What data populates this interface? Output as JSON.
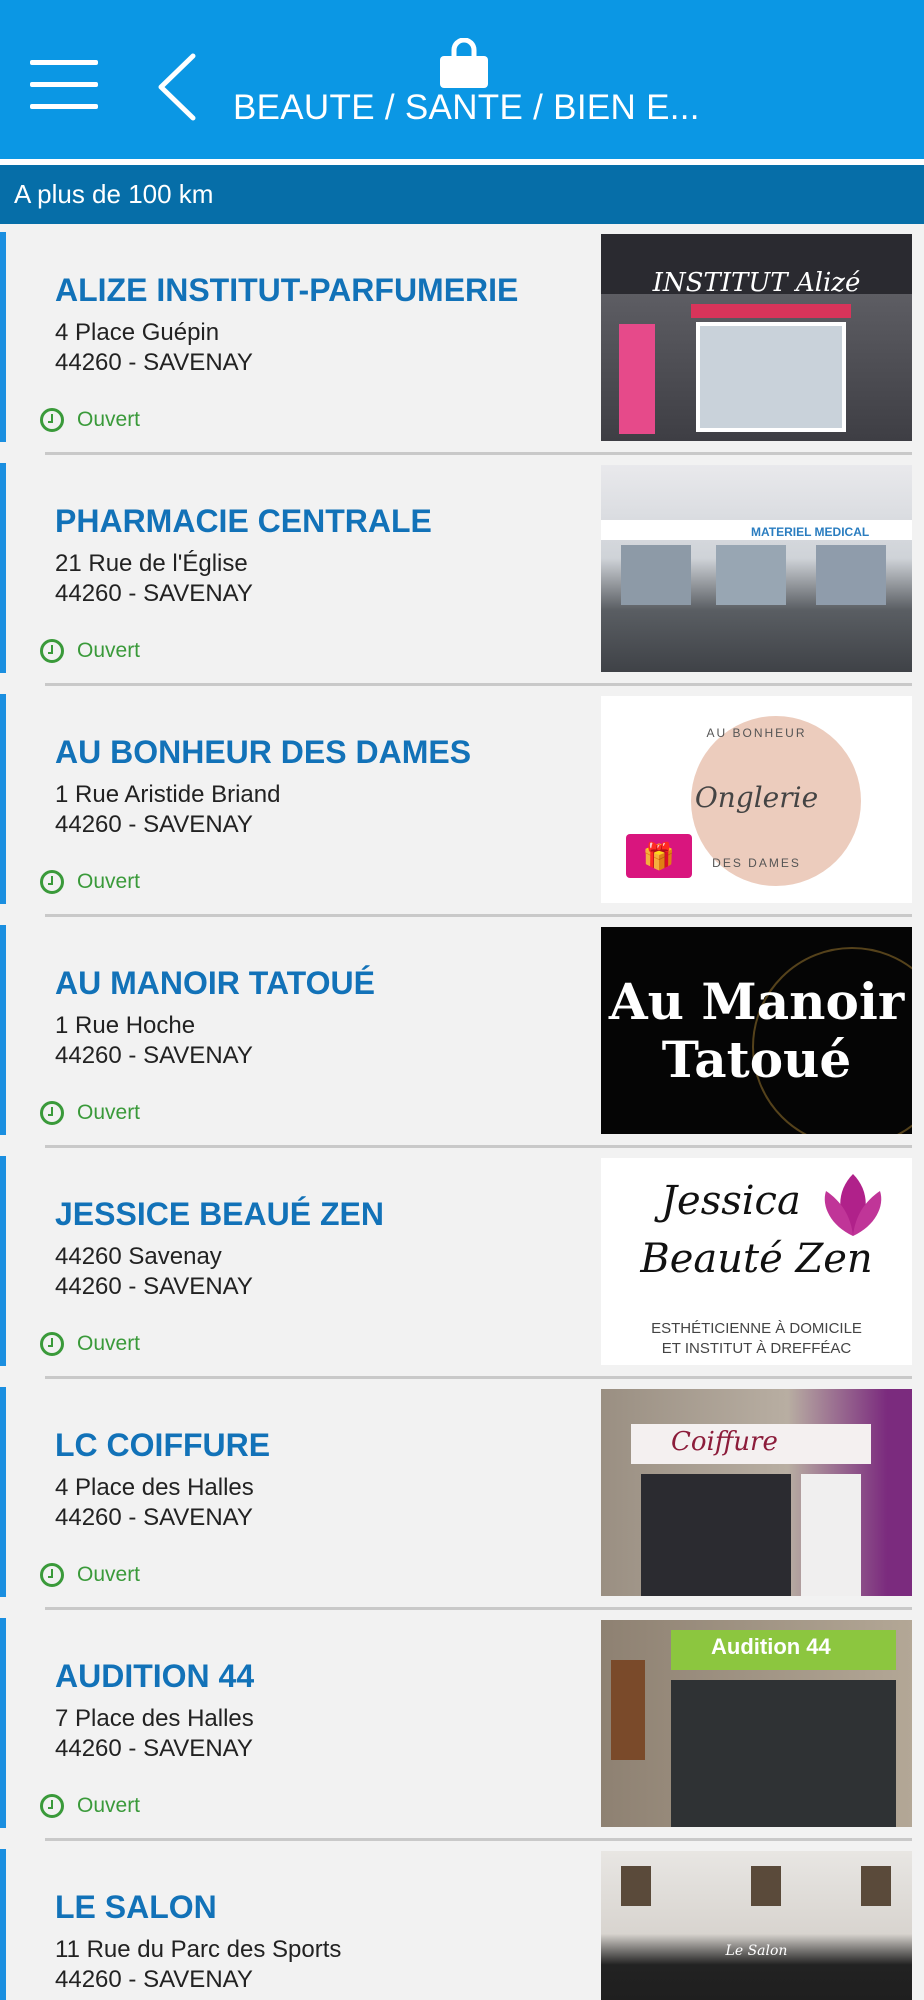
{
  "header": {
    "title": "BEAUTE / SANTE / BIEN E...",
    "menu_icon": "hamburger-icon",
    "back_icon": "chevron-left-icon",
    "category_icon": "shopping-bag-icon",
    "background_color": "#0b97e4"
  },
  "distance_bar": {
    "label": "A plus de 100 km",
    "background_color": "#066ea8"
  },
  "listings": [
    {
      "name": "ALIZE INSTITUT-PARFUMERIE",
      "street": "4 Place Guépin",
      "city": "44260 - SAVENAY",
      "status": "Ouvert",
      "image_text": "INSTITUT Alizé"
    },
    {
      "name": "PHARMACIE CENTRALE",
      "street": "21 Rue de l'Église",
      "city": "44260 - SAVENAY",
      "status": "Ouvert",
      "image_text": "MATERIEL MEDICAL"
    },
    {
      "name": "AU BONHEUR DES DAMES",
      "street": "1 Rue Aristide Briand",
      "city": "44260 - SAVENAY",
      "status": "Ouvert",
      "image_text_top": "AU BONHEUR",
      "image_text_mid": "Onglerie",
      "image_text_bottom": "DES DAMES"
    },
    {
      "name": "AU MANOIR TATOUÉ",
      "street": "1 Rue Hoche",
      "city": "44260 - SAVENAY",
      "status": "Ouvert",
      "image_text_top": "Au Manoir",
      "image_text_bottom": "Tatoué"
    },
    {
      "name": "JESSICE BEAUÉ ZEN",
      "street": "44260 Savenay",
      "city": "44260 - SAVENAY",
      "status": "Ouvert",
      "image_text_top": "Jessica",
      "image_text_mid": "Beauté Zen",
      "image_text_bottom": "ESTHÉTICIENNE À DOMICILE",
      "image_text_bottom2": "ET INSTITUT À DREFFÉAC"
    },
    {
      "name": "LC COIFFURE",
      "street": "4 Place des Halles",
      "city": "44260 - SAVENAY",
      "status": "Ouvert",
      "image_text": "Coiffure"
    },
    {
      "name": "AUDITION 44",
      "street": "7 Place des Halles",
      "city": "44260 - SAVENAY",
      "status": "Ouvert",
      "image_text": "Audition 44"
    },
    {
      "name": "LE SALON",
      "street": "11 Rue du Parc des Sports",
      "city": "44260 - SAVENAY",
      "status": "",
      "image_text": "Le Salon"
    }
  ],
  "colors": {
    "accent": "#1b8fe0",
    "name_text": "#1272b8",
    "status_open": "#3a9a3a"
  }
}
